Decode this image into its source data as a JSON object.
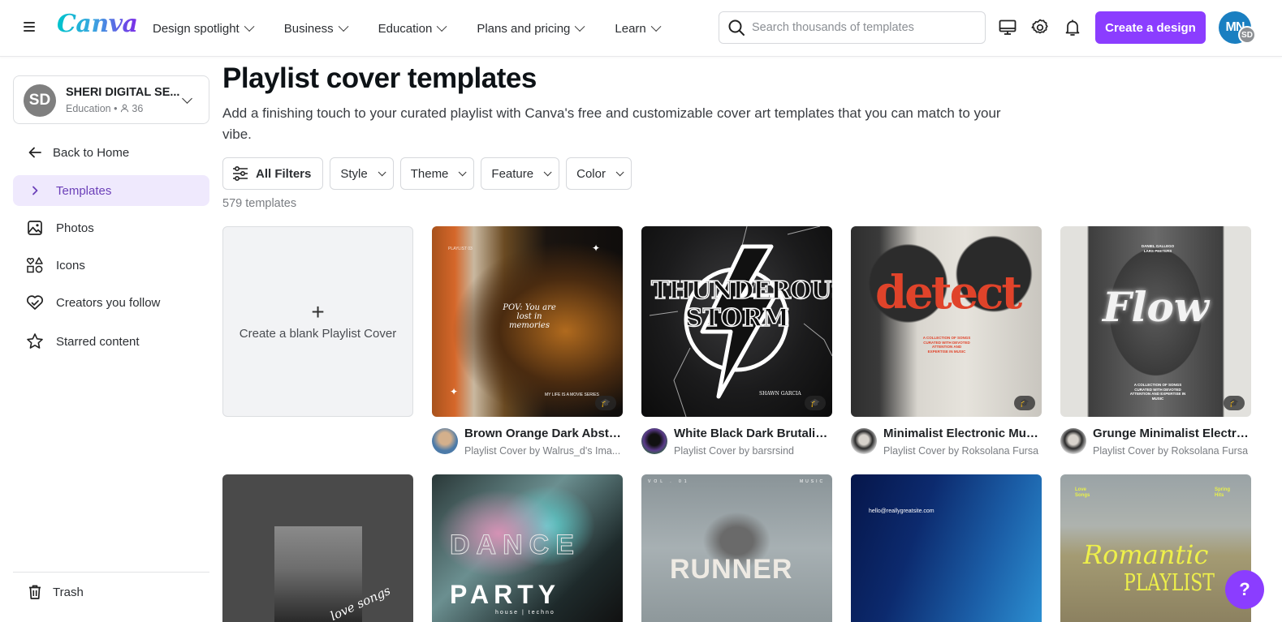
{
  "header": {
    "logo": "Canva",
    "nav": [
      {
        "label": "Design spotlight"
      },
      {
        "label": "Business"
      },
      {
        "label": "Education"
      },
      {
        "label": "Plans and pricing"
      },
      {
        "label": "Learn"
      }
    ],
    "search_placeholder": "Search thousands of templates",
    "create_label": "Create a design",
    "avatar_initials": "MN",
    "avatar_sub_initials": "SD",
    "accent": "#8b3dff"
  },
  "sidebar": {
    "team": {
      "initials": "SD",
      "name": "SHERI DIGITAL SE...",
      "type": "Education",
      "members": "36"
    },
    "back_label": "Back to Home",
    "items": [
      {
        "label": "Templates",
        "active": true
      },
      {
        "label": "Photos"
      },
      {
        "label": "Icons"
      },
      {
        "label": "Creators you follow"
      },
      {
        "label": "Starred content"
      }
    ],
    "trash_label": "Trash"
  },
  "main": {
    "title": "Playlist cover templates",
    "description": "Add a finishing touch to your curated playlist with Canva's free and customizable cover art templates that you can match to your vibe.",
    "filters": [
      {
        "label": "All Filters"
      },
      {
        "label": "Style"
      },
      {
        "label": "Theme"
      },
      {
        "label": "Feature"
      },
      {
        "label": "Color"
      }
    ],
    "count": "579 templates",
    "blank_card": {
      "label": "Create a blank Playlist Cover"
    },
    "templates": [
      {
        "title": "Brown Orange Dark Abstra...",
        "subtitle": "Playlist Cover by Walrus_d's Ima...",
        "thumb_texts": [
          "PLAYLIST 03",
          "POV: You are lost in memories",
          "MY LIFE IS A MOVIE SERIES"
        ]
      },
      {
        "title": "White Black Dark Brutalist ...",
        "subtitle": "Playlist Cover by barsrsind",
        "thumb_texts": [
          "THUNDEROUS",
          "STORM",
          "SHAWN GARCIA"
        ]
      },
      {
        "title": "Minimalist Electronic Musi...",
        "subtitle": "Playlist Cover by Roksolana Fursa",
        "thumb_texts": [
          "detect",
          "A COLLECTION OF SONGS CURATED WITH DEVOTED ATTENTION AND EXPERTISE IN MUSIC"
        ]
      },
      {
        "title": "Grunge Minimalist Electro...",
        "subtitle": "Playlist Cover by Roksolana Fursa",
        "thumb_texts": [
          "DANIEL GALLEGO",
          "LARS PEETERS",
          "Flow",
          "A COLLECTION OF SONGS CURATED WITH DEVOTED ATTENTION AND EXPERTISE IN MUSIC"
        ]
      },
      {
        "thumb_texts": [
          "love songs"
        ]
      },
      {
        "thumb_texts": [
          "DANCE",
          "PARTY",
          "house | techno"
        ]
      },
      {
        "thumb_texts": [
          "VOL . 01",
          "MUSIC",
          "RUNNER"
        ]
      },
      {
        "thumb_texts": [
          "hello@reallygreatsite.com"
        ]
      },
      {
        "thumb_texts": [
          "Love Songs",
          "Spring Hits",
          "Romantic",
          "PLAYLIST"
        ]
      }
    ]
  },
  "help_label": "?"
}
